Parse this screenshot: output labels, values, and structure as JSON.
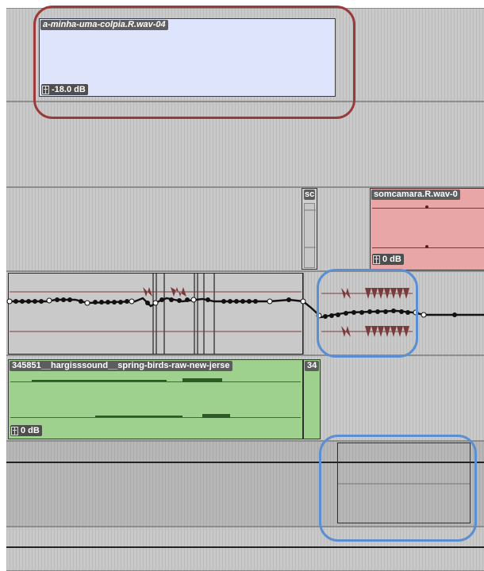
{
  "clips": {
    "top": {
      "name": "a-minha-uma-colpia.R.wav-04",
      "gain": "-18.0 dB"
    },
    "small": {
      "name": "sc"
    },
    "red": {
      "name": "somcamara.R.wav-0",
      "gain": "0 dB"
    },
    "green": {
      "name": "345851__hargisssound__spring-birds-raw-new-jerse",
      "tail": "34",
      "gain": "0 dB"
    }
  },
  "colors": {
    "clip_blue": "#dde4fb",
    "clip_red": "#e8a6a6",
    "clip_green": "#9ed08e",
    "highlight_red": "#9b3a3a",
    "highlight_blue": "#5a8fd3"
  }
}
